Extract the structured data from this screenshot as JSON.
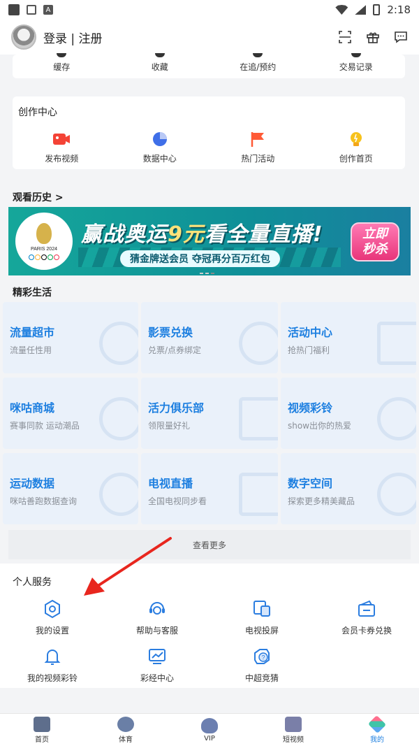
{
  "status_bar": {
    "time": "2:18",
    "app_icon_letter": "A"
  },
  "header": {
    "login_text": "登录 | 注册",
    "icons": [
      "scan-icon",
      "gift-icon",
      "message-icon"
    ]
  },
  "top_row": [
    "缓存",
    "收藏",
    "在追/预约",
    "交易记录"
  ],
  "creation": {
    "title": "创作中心",
    "items": [
      {
        "label": "发布视频",
        "icon": "video-icon",
        "color": "#f44336"
      },
      {
        "label": "数据中心",
        "icon": "pie-chart-icon",
        "color": "#3f6fe8"
      },
      {
        "label": "热门活动",
        "icon": "flag-icon",
        "color": "#ff5a36"
      },
      {
        "label": "创作首页",
        "icon": "bulb-icon",
        "color": "#f7c21c"
      }
    ]
  },
  "history_title": "观看历史 >",
  "banner": {
    "logo_text": "PARIS 2024",
    "headline_a": "赢战奥运",
    "headline_b": "9元",
    "headline_c": "看全量直播!",
    "sub": "猜金牌送会员 夺冠再分百万红包",
    "button_line1": "立即",
    "button_line2": "秒杀"
  },
  "life_title": "精彩生活",
  "life_tiles": [
    {
      "title": "流量超市",
      "subtitle": "流量任性用"
    },
    {
      "title": "影票兑换",
      "subtitle": "兑票/点券绑定"
    },
    {
      "title": "活动中心",
      "subtitle": "抢热门福利"
    },
    {
      "title": "咪咕商城",
      "subtitle": "赛事同款 运动潮品"
    },
    {
      "title": "活力俱乐部",
      "subtitle": "领限量好礼"
    },
    {
      "title": "视频彩铃",
      "subtitle": "show出你的热爱"
    },
    {
      "title": "运动数据",
      "subtitle": "咪咕善跑数据查询"
    },
    {
      "title": "电视直播",
      "subtitle": "全国电视同步看"
    },
    {
      "title": "数字空间",
      "subtitle": "探索更多精美藏品"
    }
  ],
  "more_label": "查看更多",
  "personal": {
    "title": "个人服务",
    "row1": [
      {
        "label": "我的设置",
        "icon": "settings-icon"
      },
      {
        "label": "帮助与客服",
        "icon": "customer-service-icon"
      },
      {
        "label": "电视投屏",
        "icon": "cast-screen-icon"
      },
      {
        "label": "会员卡券兑换",
        "icon": "wallet-icon"
      }
    ],
    "row2": [
      {
        "label": "我的视频彩铃",
        "icon": "bell-icon"
      },
      {
        "label": "彩经中心",
        "icon": "trend-chart-icon"
      },
      {
        "label": "中超竞猜",
        "icon": "quiz-icon"
      }
    ]
  },
  "bottom_nav": [
    {
      "label": "首页",
      "icon": "home-tab-icon",
      "color": "#5e6e8c"
    },
    {
      "label": "体育",
      "icon": "sports-tab-icon",
      "color": "#6a7fa6"
    },
    {
      "label": "VIP",
      "icon": "vip-tab-icon",
      "color": "#6c7fb0"
    },
    {
      "label": "短视频",
      "icon": "short-video-tab-icon",
      "color": "#7a7fa8"
    },
    {
      "label": "我的",
      "icon": "mine-tab-icon",
      "color": "#3fc4a8",
      "active": true
    }
  ],
  "accent_color": "#1d7fe0",
  "arrow_color": "#e8261e"
}
